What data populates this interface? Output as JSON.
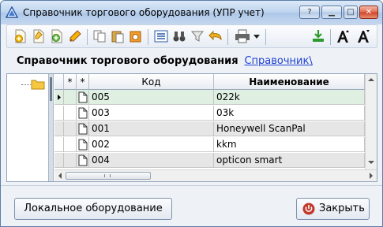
{
  "window": {
    "title": "Справочник торгового оборудования (УПР учет)",
    "controls": {
      "help": "?",
      "minimize": "▁",
      "maximize": "□",
      "close": "✕"
    }
  },
  "toolbar": {
    "items": [
      "add-icon",
      "copy-new-icon",
      "add-group-icon",
      "edit-pencil-icon",
      "copy-icon",
      "paste-icon",
      "delete-icon",
      "list-icon",
      "find-binoculars-icon",
      "filter-icon",
      "back-arrow-icon",
      "print-icon",
      "print-dropdown-icon",
      "export-icon",
      "font-increase-icon",
      "font-decrease-icon"
    ]
  },
  "header": {
    "title": "Справочник торгового оборудования",
    "link": "Справочник\\"
  },
  "grid": {
    "columns": {
      "star1": "*",
      "star2": "*",
      "code": "Код",
      "name": "Наименование"
    },
    "rows": [
      {
        "code": "005",
        "name": "022k",
        "selected": true
      },
      {
        "code": "003",
        "name": "03k",
        "selected": false
      },
      {
        "code": "001",
        "name": "Honeywell ScanPal",
        "selected": false
      },
      {
        "code": "002",
        "name": "kkm",
        "selected": false
      },
      {
        "code": "004",
        "name": "opticon smart",
        "selected": false
      }
    ]
  },
  "footer": {
    "local_button": "Локальное оборудование",
    "close_button": "Закрыть"
  },
  "colors": {
    "selected_row": "#dff0e3",
    "alt_row": "#e6e6e6",
    "link": "#1c3fd1",
    "close_icon": "#c0392b"
  }
}
